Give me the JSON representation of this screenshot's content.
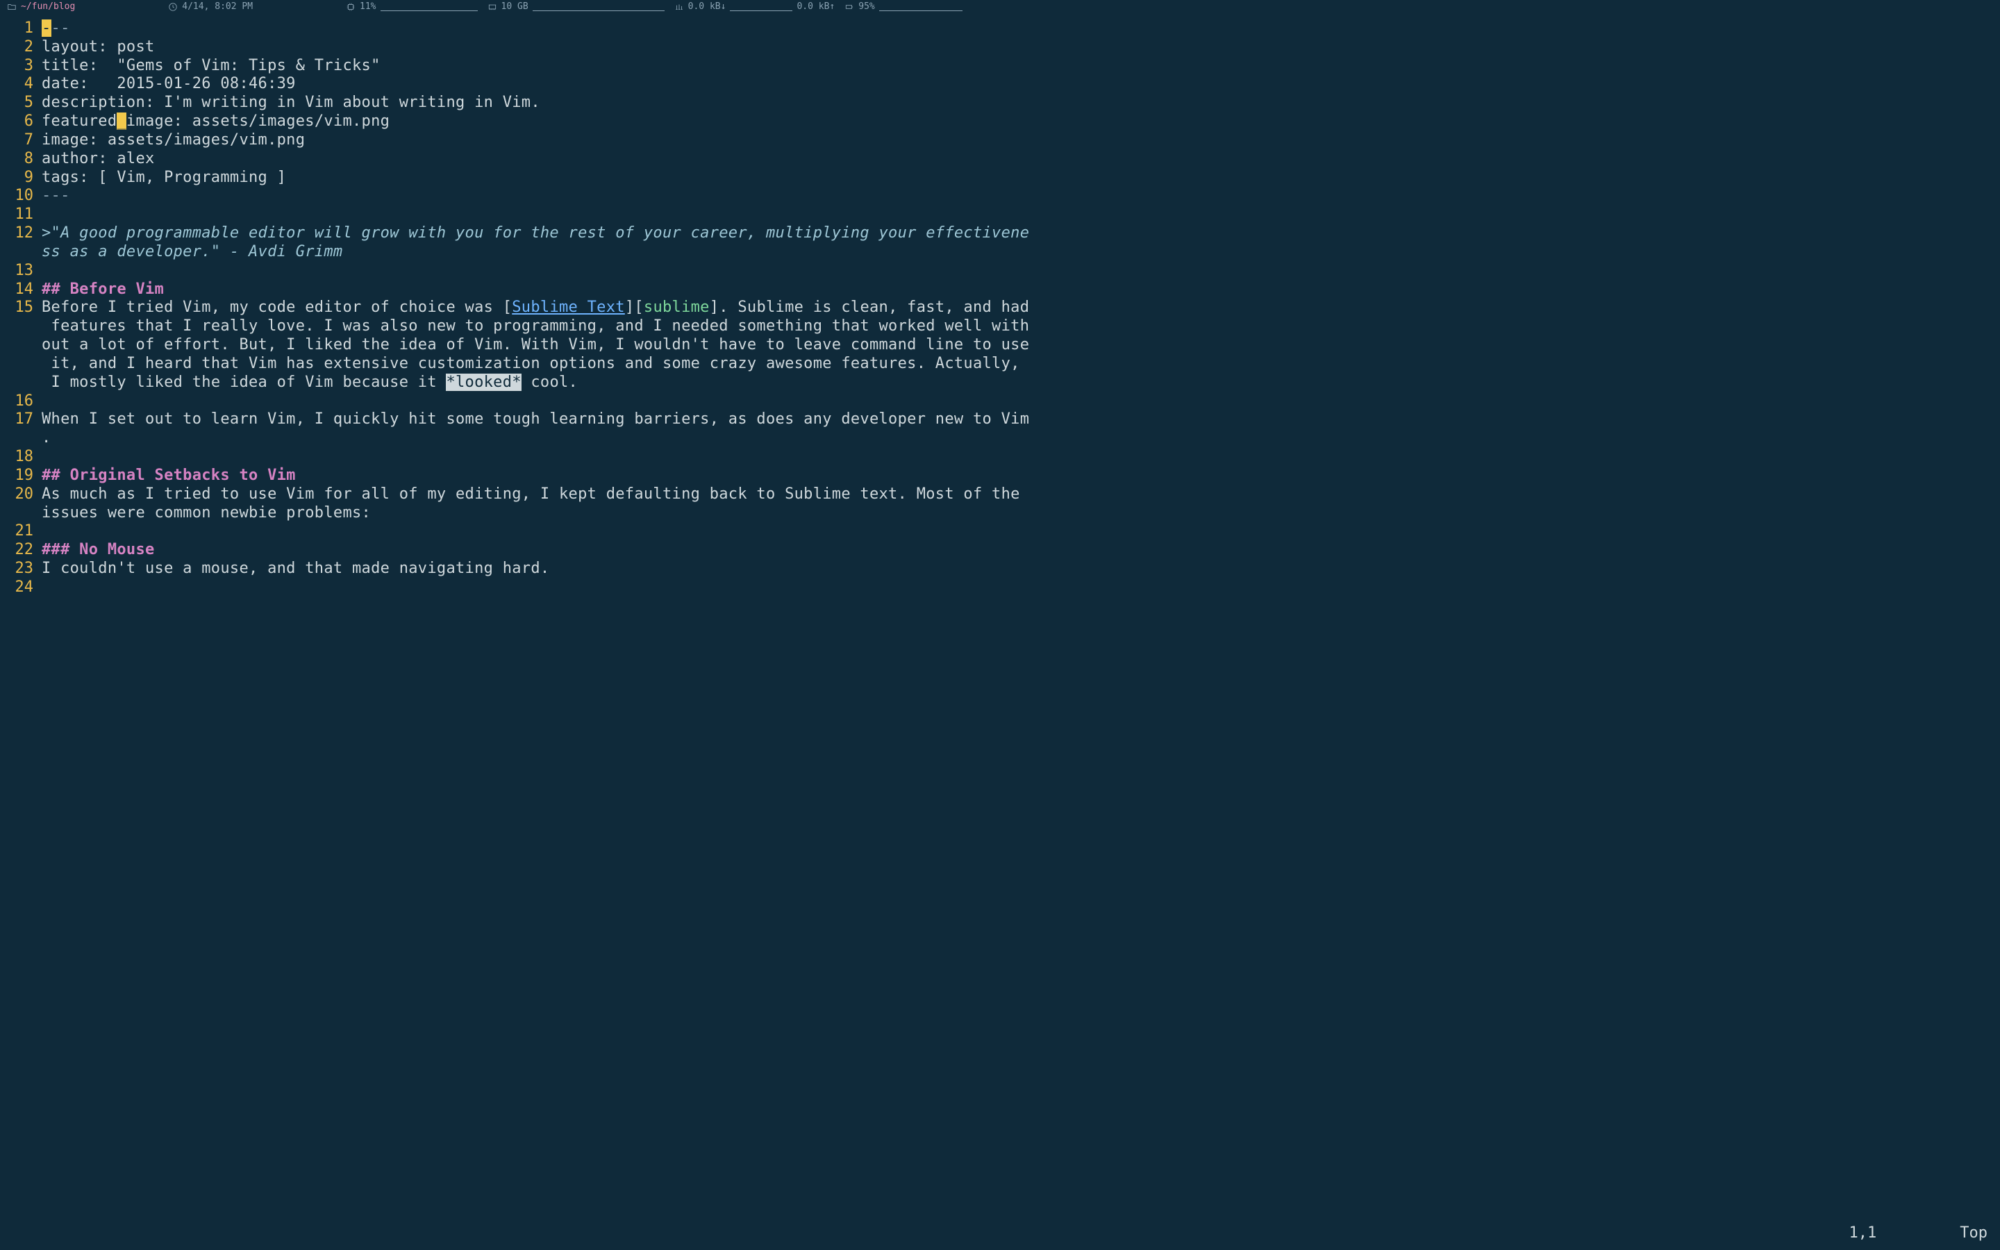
{
  "topbar": {
    "path": "~/fun/blog",
    "clock": "4/14, 8:02 PM",
    "cpu": "11%",
    "memory": "10 GB",
    "net_down": "0.0 kB↓",
    "net_up": "0.0 kB↑",
    "battery": "95%"
  },
  "gutter": {
    "start": 1,
    "end": 24
  },
  "colors": {
    "link": "#6fb4ff",
    "bracket": "#7fd99c",
    "heading": "#d683c3",
    "cursor": "#f2c94c"
  },
  "content": {
    "l1_dash_rest": "--",
    "l1_cursor_char": "-",
    "l2": "layout: post",
    "l3": "title:  \"Gems of Vim: Tips & Tricks\"",
    "l4": "date:   2015-01-26 08:46:39",
    "l5": "description: I'm writing in Vim about writing in Vim.",
    "l6a": "featured",
    "l6b": "image: assets/images/vim.png",
    "l6_cursor_char": "_",
    "l7": "image: assets/images/vim.png",
    "l8": "author: alex",
    "l9": "tags: [ Vim, Programming ]",
    "l10": "---",
    "l12a": ">\"A good programmable editor will grow with you for the rest of your career, multiplying your effectivene",
    "l12b": "ss as a developer.\" - Avdi Grimm",
    "l14": "## Before Vim",
    "l15_pre": "Before I tried Vim, my code editor of choice was [",
    "l15_link": "Sublime Text",
    "l15_mid": "][",
    "l15_ref": "sublime",
    "l15_post_a": "]. Sublime is clean, fast, and had",
    "l15_wrap1": " features that I really love. I was also new to programming, and I needed something that worked well with",
    "l15_wrap2": "out a lot of effort. But, I liked the idea of Vim. With Vim, I wouldn't have to leave command line to use",
    "l15_wrap3": " it, and I heard that Vim has extensive customization options and some crazy awesome features. Actually,",
    "l15_wrap4a": " I mostly liked the idea of Vim because it ",
    "l15_sel": "*looked*",
    "l15_wrap4b": " cool.",
    "l17a": "When I set out to learn Vim, I quickly hit some tough learning barriers, as does any developer new to Vim",
    "l17b": ".",
    "l19": "## Original Setbacks to Vim",
    "l20a": "As much as I tried to use Vim for all of my editing, I kept defaulting back to Sublime text. Most of the ",
    "l20b": "issues were common newbie problems:",
    "l22": "### No Mouse",
    "l23": "I couldn't use a mouse, and that made navigating hard."
  },
  "ruler": {
    "position": "1,1",
    "scroll": "Top"
  }
}
